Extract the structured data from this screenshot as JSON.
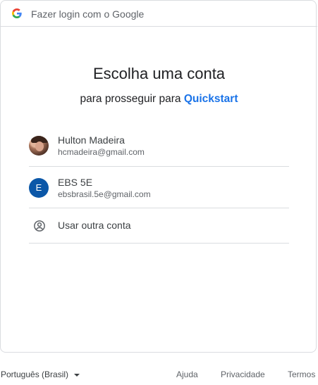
{
  "header": {
    "title": "Fazer login com o Google",
    "logo_icon": "google-g-icon"
  },
  "main": {
    "title": "Escolha uma conta",
    "subtitle_prefix": "para prosseguir para ",
    "app_name": "Quickstart",
    "accent_color": "#1a73e8"
  },
  "accounts": [
    {
      "name": "Hulton Madeira",
      "email": "hcmadeira@gmail.com",
      "avatar": "profile-photo"
    },
    {
      "name": "EBS 5E",
      "email": "ebsbrasil.5e@gmail.com",
      "avatar_letter": "E",
      "avatar_color": "#0b57a8"
    }
  ],
  "other_account": {
    "label": "Usar outra conta",
    "icon": "account-circle-icon"
  },
  "footer": {
    "language": "Português (Brasil)",
    "help": "Ajuda",
    "privacy": "Privacidade",
    "terms": "Termos"
  }
}
